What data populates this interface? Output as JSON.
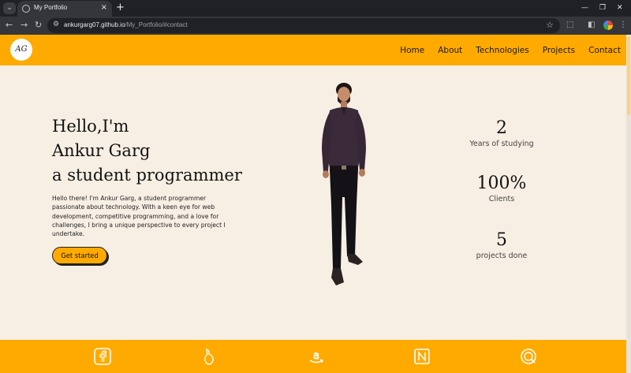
{
  "browser": {
    "tab_title": "My Portfolio",
    "url_host": "ankurgarg07.github.io",
    "url_path": "/My_Portfolio/#contact"
  },
  "nav": {
    "logo_text": "AG",
    "links": [
      "Home",
      "About",
      "Technologies",
      "Projects",
      "Contact"
    ]
  },
  "hero": {
    "title_lines": [
      "Hello,I'm",
      "Ankur Garg",
      "a student programmer"
    ],
    "description": "Hello there! I'm Ankur Garg, a student programmer passionate about technology. With a keen eye for web development, competitive programming, and a love for challenges, I bring a unique perspective to every project I undertake.",
    "cta_label": "Get started"
  },
  "stats": [
    {
      "value": "2",
      "label": "Years of studying"
    },
    {
      "value": "100%",
      "label": "Clients"
    },
    {
      "value": "5",
      "label": "projects done"
    }
  ],
  "footer": {
    "icons": [
      "facebook-icon",
      "codechef-icon",
      "amazon-icon",
      "notion-icon",
      "leetcode-icon"
    ]
  },
  "colors": {
    "accent": "#ffaa00",
    "background": "#f8efe4"
  }
}
